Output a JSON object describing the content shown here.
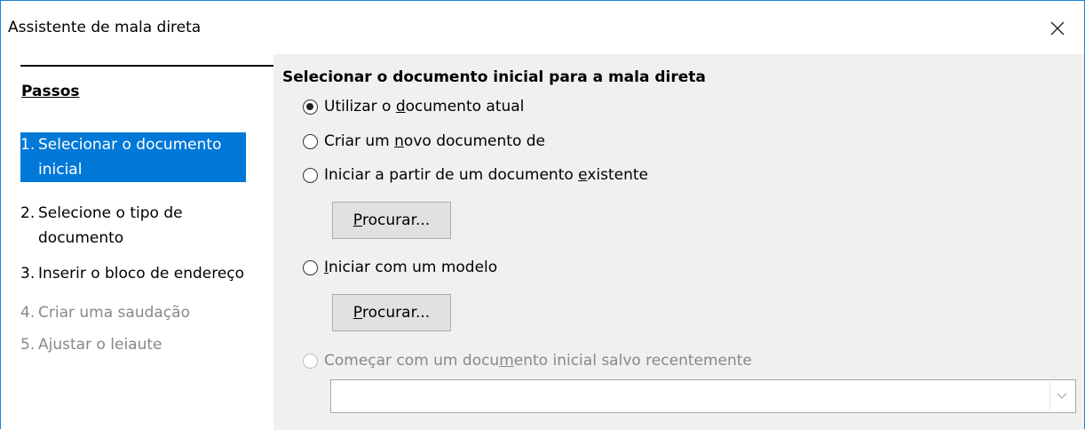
{
  "window": {
    "title": "Assistente de mala direta"
  },
  "steps": {
    "heading": "Passos",
    "items": [
      {
        "num": "1.",
        "label": "Selecionar o documento inicial",
        "state": "active"
      },
      {
        "num": "2.",
        "label": "Selecione o tipo de documento",
        "state": "normal"
      },
      {
        "num": "3.",
        "label": "Inserir o bloco de endereço",
        "state": "normal"
      },
      {
        "num": "4.",
        "label": "Criar uma saudação",
        "state": "disabled"
      },
      {
        "num": "5.",
        "label": "Ajustar o leiaute",
        "state": "disabled"
      }
    ]
  },
  "main": {
    "title": "Selecionar o documento inicial para a mala direta",
    "options": {
      "current": {
        "pre": "Utilizar o ",
        "key": "d",
        "post": "ocumento atual",
        "checked": true
      },
      "new": {
        "pre": "Criar um ",
        "key": "n",
        "post": "ovo documento de",
        "checked": false
      },
      "existing": {
        "pre": "Iniciar a partir de um documento ",
        "key": "e",
        "post": "xistente",
        "checked": false
      },
      "template": {
        "pre": "",
        "key": "I",
        "post": "niciar com um modelo",
        "checked": false
      },
      "recent": {
        "pre": "Começar com um docu",
        "key": "m",
        "post": "ento inicial salvo recentemente",
        "checked": false,
        "disabled": true
      }
    },
    "browse1": {
      "key": "P",
      "rest": "rocurar..."
    },
    "browse2": {
      "key": "P",
      "rest": "rocurar..."
    },
    "recent_combo": {
      "value": ""
    }
  },
  "colors": {
    "accent": "#0078d7",
    "panel_bg": "#f0f0f0",
    "disabled_text": "#888888",
    "window_border": "#1883d7"
  },
  "icons": {
    "close": "close-icon",
    "dropdown": "chevron-down-icon"
  }
}
